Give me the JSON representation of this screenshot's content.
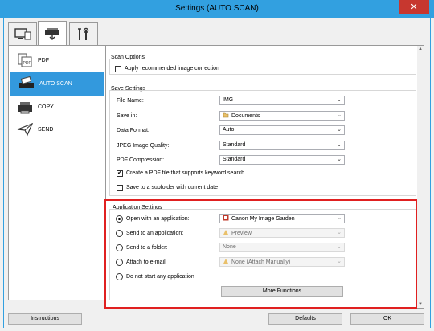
{
  "window": {
    "title": "Settings (AUTO SCAN)",
    "close": "✕"
  },
  "tabs": [
    {
      "name": "computer-scan-tab"
    },
    {
      "name": "scanner-tab"
    },
    {
      "name": "tools-tab"
    }
  ],
  "nav": [
    {
      "label": "PDF"
    },
    {
      "label": "AUTO SCAN"
    },
    {
      "label": "COPY"
    },
    {
      "label": "SEND"
    }
  ],
  "scan_options": {
    "title": "Scan Options",
    "apply_correction": "Apply recommended image correction"
  },
  "save_settings": {
    "title": "Save Settings",
    "file_name_label": "File Name:",
    "file_name_value": "IMG",
    "save_in_label": "Save in:",
    "save_in_value": "Documents",
    "data_format_label": "Data Format:",
    "data_format_value": "Auto",
    "jpeg_quality_label": "JPEG Image Quality:",
    "jpeg_quality_value": "Standard",
    "pdf_compression_label": "PDF Compression:",
    "pdf_compression_value": "Standard",
    "create_pdf_keyword": "Create a PDF file that supports keyword search",
    "save_subfolder": "Save to a subfolder with current date"
  },
  "app_settings": {
    "title": "Application Settings",
    "open_with_label": "Open with an application:",
    "open_with_value": "Canon My Image Garden",
    "send_app_label": "Send to an application:",
    "send_app_value": "Preview",
    "send_folder_label": "Send to a folder:",
    "send_folder_value": "None",
    "attach_email_label": "Attach to e-mail:",
    "attach_email_value": "None (Attach Manually)",
    "do_not_start_label": "Do not start any application",
    "more_functions": "More Functions"
  },
  "footer": {
    "instructions": "Instructions",
    "defaults": "Defaults",
    "ok": "OK"
  },
  "colors": {
    "title_bar": "#32a0e0",
    "close_button": "#c7372f",
    "nav_selected": "#3399dd",
    "highlight_border": "#e02020"
  }
}
